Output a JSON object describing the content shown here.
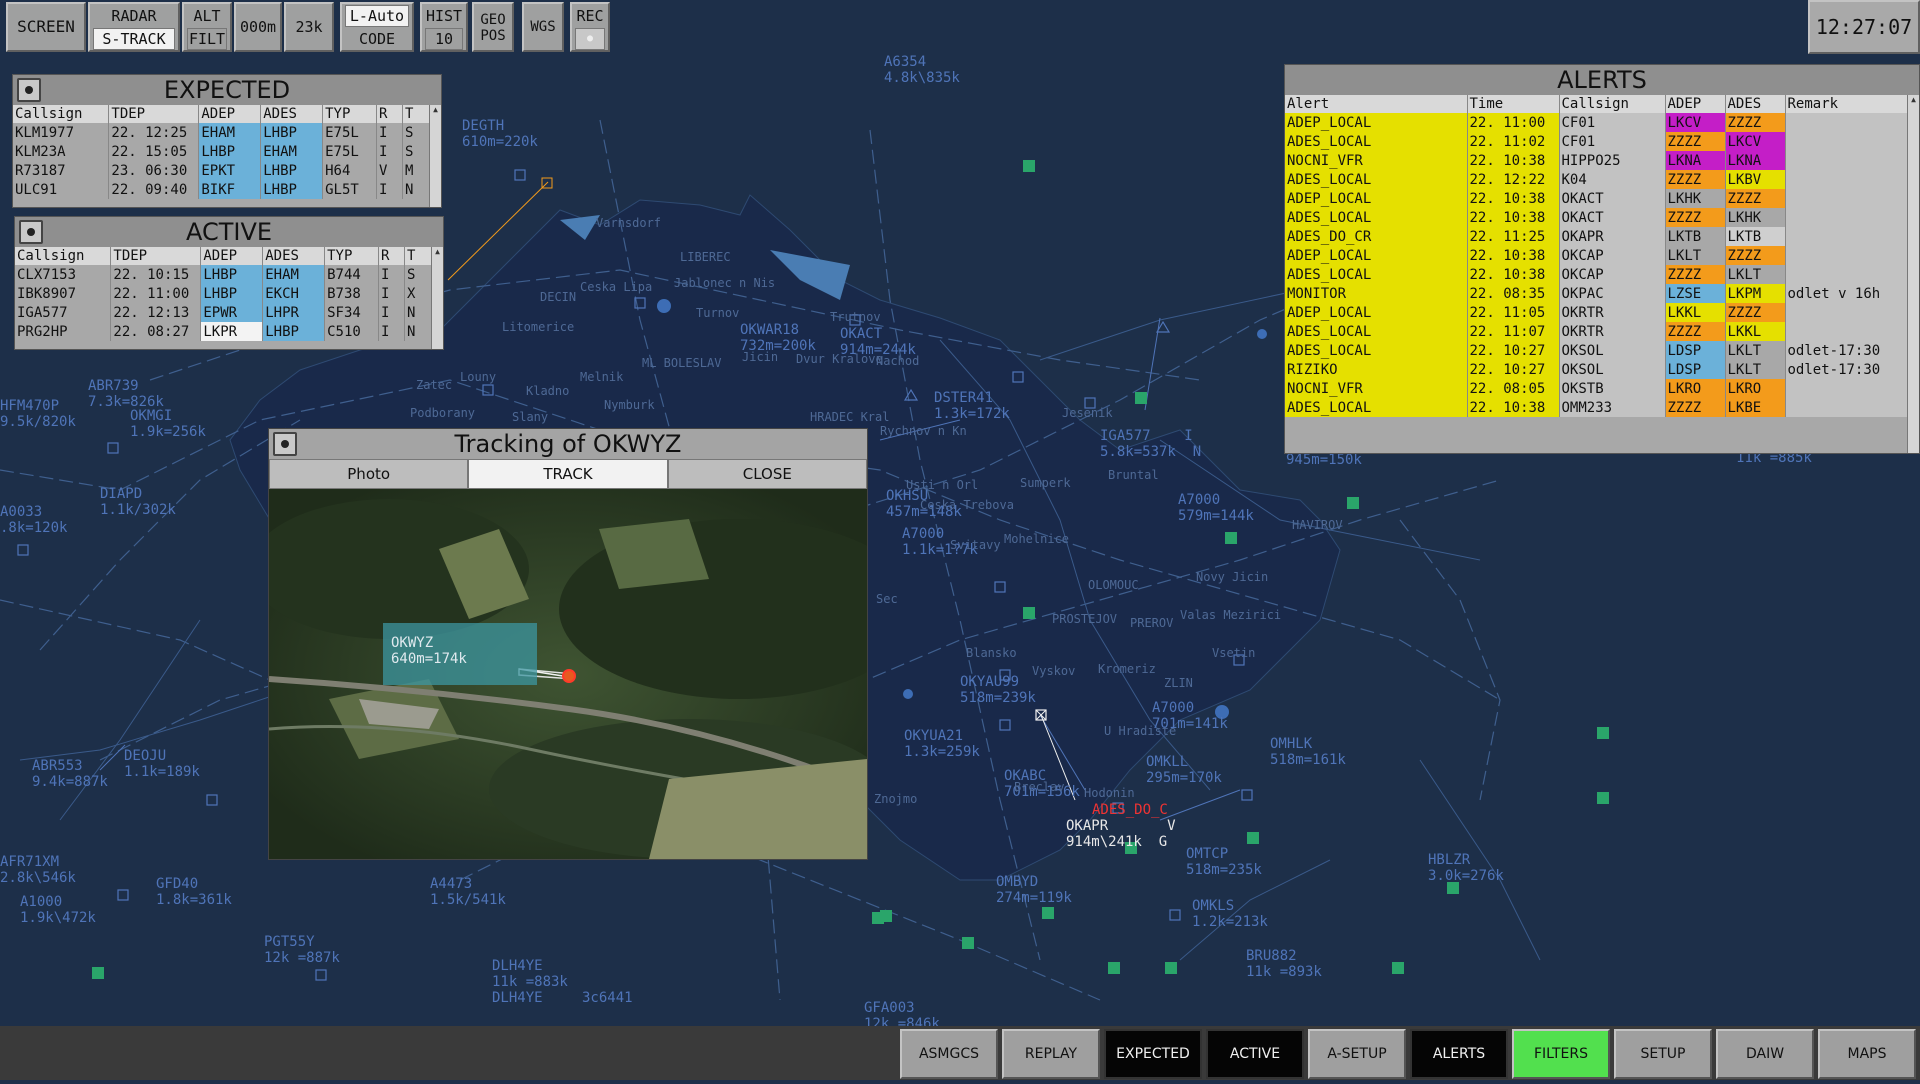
{
  "toolbar": {
    "screen": "SCREEN",
    "radar": "RADAR",
    "strack": "S-TRACK",
    "alt": "ALT",
    "filt": "FILT",
    "lower": "000m",
    "upper": "23k",
    "lauto": "L-Auto",
    "code": "CODE",
    "hist": "HIST",
    "hist_val": "10",
    "geo": "GEO\nPOS",
    "wgs": "WGS",
    "rec": "REC",
    "rec_dot": "●"
  },
  "clock": "12:27:07",
  "expected": {
    "title": "EXPECTED",
    "columns": [
      "Callsign",
      "TDEP",
      "ADEP",
      "ADES",
      "TYP",
      "R",
      "T"
    ],
    "rows": [
      {
        "callsign": "KLM1977",
        "tdep": "22. 12:25",
        "adep": "EHAM",
        "ades": "LHBP",
        "typ": "E75L",
        "r": "I",
        "t": "S"
      },
      {
        "callsign": "KLM23A",
        "tdep": "22. 15:05",
        "adep": "LHBP",
        "ades": "EHAM",
        "typ": "E75L",
        "r": "I",
        "t": "S"
      },
      {
        "callsign": "R73187",
        "tdep": "23. 06:30",
        "adep": "EPKT",
        "ades": "LHBP",
        "typ": "H64",
        "r": "V",
        "t": "M"
      },
      {
        "callsign": "ULC91",
        "tdep": "22. 09:40",
        "adep": "BIKF",
        "ades": "LHBP",
        "typ": "GL5T",
        "r": "I",
        "t": "N"
      }
    ]
  },
  "active": {
    "title": "ACTIVE",
    "columns": [
      "Callsign",
      "TDEP",
      "ADEP",
      "ADES",
      "TYP",
      "R",
      "T"
    ],
    "rows": [
      {
        "callsign": "CLX7153",
        "tdep": "22. 10:15",
        "adep": "LHBP",
        "ades": "EHAM",
        "typ": "B744",
        "r": "I",
        "t": "S"
      },
      {
        "callsign": "IBK8907",
        "tdep": "22. 11:00",
        "adep": "LHBP",
        "ades": "EKCH",
        "typ": "B738",
        "r": "I",
        "t": "X"
      },
      {
        "callsign": "IGA577",
        "tdep": "22. 12:13",
        "adep": "EPWR",
        "ades": "LHPR",
        "typ": "SF34",
        "r": "I",
        "t": "N"
      },
      {
        "callsign": "PRG2HP",
        "tdep": "22. 08:27",
        "adep": "LKPR",
        "ades": "LHBP",
        "typ": "C510",
        "r": "I",
        "t": "N"
      }
    ]
  },
  "alerts": {
    "title": "ALERTS",
    "columns": [
      "Alert",
      "Time",
      "Callsign",
      "ADEP",
      "ADES",
      "Remark"
    ],
    "rows": [
      {
        "alert": "ADEP_LOCAL",
        "time": "22. 11:00",
        "callsign": "CF01",
        "adep": "LKCV",
        "ades": "ZZZZ",
        "remark": "",
        "adep_c": "magenta",
        "ades_c": "orange"
      },
      {
        "alert": "ADES_LOCAL",
        "time": "22. 11:02",
        "callsign": "CF01",
        "adep": "ZZZZ",
        "ades": "LKCV",
        "remark": "",
        "adep_c": "orange",
        "ades_c": "magenta"
      },
      {
        "alert": "NOCNI_VFR",
        "time": "22. 10:38",
        "callsign": "HIPPO25",
        "adep": "LKNA",
        "ades": "LKNA",
        "remark": "",
        "adep_c": "magenta",
        "ades_c": "magenta"
      },
      {
        "alert": "ADES_LOCAL",
        "time": "22. 12:22",
        "callsign": "K04",
        "adep": "ZZZZ",
        "ades": "LKBV",
        "remark": "",
        "adep_c": "orange",
        "ades_c": "yellow"
      },
      {
        "alert": "ADEP_LOCAL",
        "time": "22. 10:38",
        "callsign": "OKACT",
        "adep": "LKHK",
        "ades": "ZZZZ",
        "remark": "",
        "adep_c": "none",
        "ades_c": "orange"
      },
      {
        "alert": "ADES_LOCAL",
        "time": "22. 10:38",
        "callsign": "OKACT",
        "adep": "ZZZZ",
        "ades": "LKHK",
        "remark": "",
        "adep_c": "orange",
        "ades_c": "none"
      },
      {
        "alert": "ADES_DO_CR",
        "time": "22. 11:25",
        "callsign": "OKAPR",
        "adep": "LKTB",
        "ades": "LKTB",
        "remark": "",
        "adep_c": "none",
        "ades_c": "pale"
      },
      {
        "alert": "ADEP_LOCAL",
        "time": "22. 10:38",
        "callsign": "OKCAP",
        "adep": "LKLT",
        "ades": "ZZZZ",
        "remark": "",
        "adep_c": "none",
        "ades_c": "orange"
      },
      {
        "alert": "ADES_LOCAL",
        "time": "22. 10:38",
        "callsign": "OKCAP",
        "adep": "ZZZZ",
        "ades": "LKLT",
        "remark": "",
        "adep_c": "orange",
        "ades_c": "none"
      },
      {
        "alert": "MONITOR",
        "time": "22. 08:35",
        "callsign": "OKPAC",
        "adep": "LZSE",
        "ades": "LKPM",
        "remark": "odlet v 16h",
        "adep_c": "blue",
        "ades_c": "yellow"
      },
      {
        "alert": "ADEP_LOCAL",
        "time": "22. 11:05",
        "callsign": "OKRTR",
        "adep": "LKKL",
        "ades": "ZZZZ",
        "remark": "",
        "adep_c": "yellow",
        "ades_c": "orange"
      },
      {
        "alert": "ADES_LOCAL",
        "time": "22. 11:07",
        "callsign": "OKRTR",
        "adep": "ZZZZ",
        "ades": "LKKL",
        "remark": "",
        "adep_c": "orange",
        "ades_c": "yellow"
      },
      {
        "alert": "ADES_LOCAL",
        "time": "22. 10:27",
        "callsign": "OKSOL",
        "adep": "LDSP",
        "ades": "LKLT",
        "remark": "odlet-17:30",
        "adep_c": "blue",
        "ades_c": "none"
      },
      {
        "alert": "RIZIKO",
        "time": "22. 10:27",
        "callsign": "OKSOL",
        "adep": "LDSP",
        "ades": "LKLT",
        "remark": "odlet-17:30",
        "adep_c": "blue",
        "ades_c": "none"
      },
      {
        "alert": "NOCNI_VFR",
        "time": "22. 08:05",
        "callsign": "OKSTB",
        "adep": "LKRO",
        "ades": "LKRO",
        "remark": "",
        "adep_c": "orange",
        "ades_c": "orange"
      },
      {
        "alert": "ADES_LOCAL",
        "time": "22. 10:38",
        "callsign": "OMM233",
        "adep": "ZZZZ",
        "ades": "LKBE",
        "remark": "",
        "adep_c": "orange",
        "ades_c": "orange"
      }
    ]
  },
  "tracking": {
    "title": "Tracking of OKWYZ",
    "tabs": [
      "Photo",
      "TRACK",
      "CLOSE"
    ],
    "label_line1": "OKWYZ",
    "label_line2": "640m=174k"
  },
  "bottom": [
    "ASMGCS",
    "REPLAY",
    "EXPECTED",
    "ACTIVE",
    "A-SETUP",
    "ALERTS",
    "FILTERS",
    "SETUP",
    "DAIW",
    "MAPS"
  ],
  "map_labels": [
    {
      "t": "A6354\n4.8k\\835k",
      "c": ""
    },
    {
      "t": "DEGTH\n610m=220k",
      "c": ""
    },
    {
      "t": "OKWAR18\n732m=200k",
      "c": ""
    },
    {
      "t": "OKACT\n914m=244k",
      "c": ""
    },
    {
      "t": "DSTER41\n1.3k=172k",
      "c": ""
    },
    {
      "t": "IGA577    I\n5.8k=537k  N",
      "c": ""
    },
    {
      "t": "A7000\n579m=144k",
      "c": ""
    },
    {
      "t": "ABR739\n7.3k=826k",
      "c": ""
    },
    {
      "t": "OKMGI\n1.9k=256k",
      "c": ""
    },
    {
      "t": "HFM470P\n9.5k/820k",
      "c": ""
    },
    {
      "t": "DIAPD\n1.1k/302k",
      "c": ""
    },
    {
      "t": "A0033\n.8k=120k",
      "c": ""
    },
    {
      "t": "OKHSU\n457m=148k",
      "c": ""
    },
    {
      "t": "A7000\n1.1k=1?7k",
      "c": ""
    },
    {
      "t": "OKYAU99\n518m=239k",
      "c": ""
    },
    {
      "t": "OKYUA21\n1.3k=259k",
      "c": ""
    },
    {
      "t": "A7000\n701m=141k",
      "c": ""
    },
    {
      "t": "OKABC\n701m=156k",
      "c": ""
    },
    {
      "t": "OMKLL\n295m=170k",
      "c": ""
    },
    {
      "t": "OMHLK\n518m=161k",
      "c": ""
    },
    {
      "t": "ADES_DO_C",
      "c": "red"
    },
    {
      "t": "OKAPR       V\n914m\\241k  G",
      "c": "wht"
    },
    {
      "t": "OMTCP\n518m=235k",
      "c": ""
    },
    {
      "t": "HBLZR\n3.0k=276k",
      "c": ""
    },
    {
      "t": "OMKLS\n1.2k=213k",
      "c": ""
    },
    {
      "t": "OMBYD\n274m=119k",
      "c": ""
    },
    {
      "t": "BRU882\n11k =893k",
      "c": ""
    },
    {
      "t": "ABR553\n9.4k=887k",
      "c": ""
    },
    {
      "t": "DEOJU\n1.1k=189k",
      "c": ""
    },
    {
      "t": "AFR71XM\n2.8k\\546k",
      "c": ""
    },
    {
      "t": "A1000\n1.9k\\472k",
      "c": ""
    },
    {
      "t": "GFD40\n1.8k=361k",
      "c": ""
    },
    {
      "t": "A4473\n1.5k/541k",
      "c": ""
    },
    {
      "t": "PGT55Y\n12k =887k",
      "c": ""
    },
    {
      "t": "DLH4YE\n11k =883k\nDLH4YE",
      "c": ""
    },
    {
      "t": "3c6441",
      "c": ""
    },
    {
      "t": "GFA003\n12k =846k",
      "c": ""
    },
    {
      "t": "11k =885k",
      "c": ""
    },
    {
      "t": "945m=150k",
      "c": ""
    }
  ],
  "towns": [
    "Varnsdorf",
    "DECIN",
    "Ceska Lipa",
    "LIBEREC",
    "Jablonec n Nis",
    "Trutnov",
    "Turnov",
    "Jicin",
    "Dvur Kralove",
    "Nachod",
    "Litomerice",
    "Melnik",
    "ML BOLESLAV",
    "Louny",
    "Podborany",
    "Zatec",
    "Kladno",
    "Nymburk",
    "HRADEC Kral",
    "Rychnov n Kn",
    "Jesenik",
    "Bruntal",
    "Sumperk",
    "Usti n Orl",
    "Ceska Trebova",
    "Mohelnice",
    "Svitavy",
    "HAVIROV",
    "Novy Jicin",
    "OLOMOUC",
    "PREROV",
    "PROSTEJOV",
    "Valas Mezirici",
    "Vsetin",
    "Blansko",
    "Vyskov",
    "Kromeriz",
    "ZLIN",
    "U Hradiste",
    "Breclav",
    "Hodonin",
    "Znojmo",
    "Sec",
    "Slany"
  ],
  "colors": {
    "background": "#1d2f49",
    "land": "#19294a",
    "label": "#4f74b8",
    "alert_yellow": "#e5e000",
    "alert_orange": "#f39b1b",
    "alert_magenta": "#c41ec7",
    "alert_blue": "#6bb1d9",
    "filters_green": "#52e04e"
  }
}
